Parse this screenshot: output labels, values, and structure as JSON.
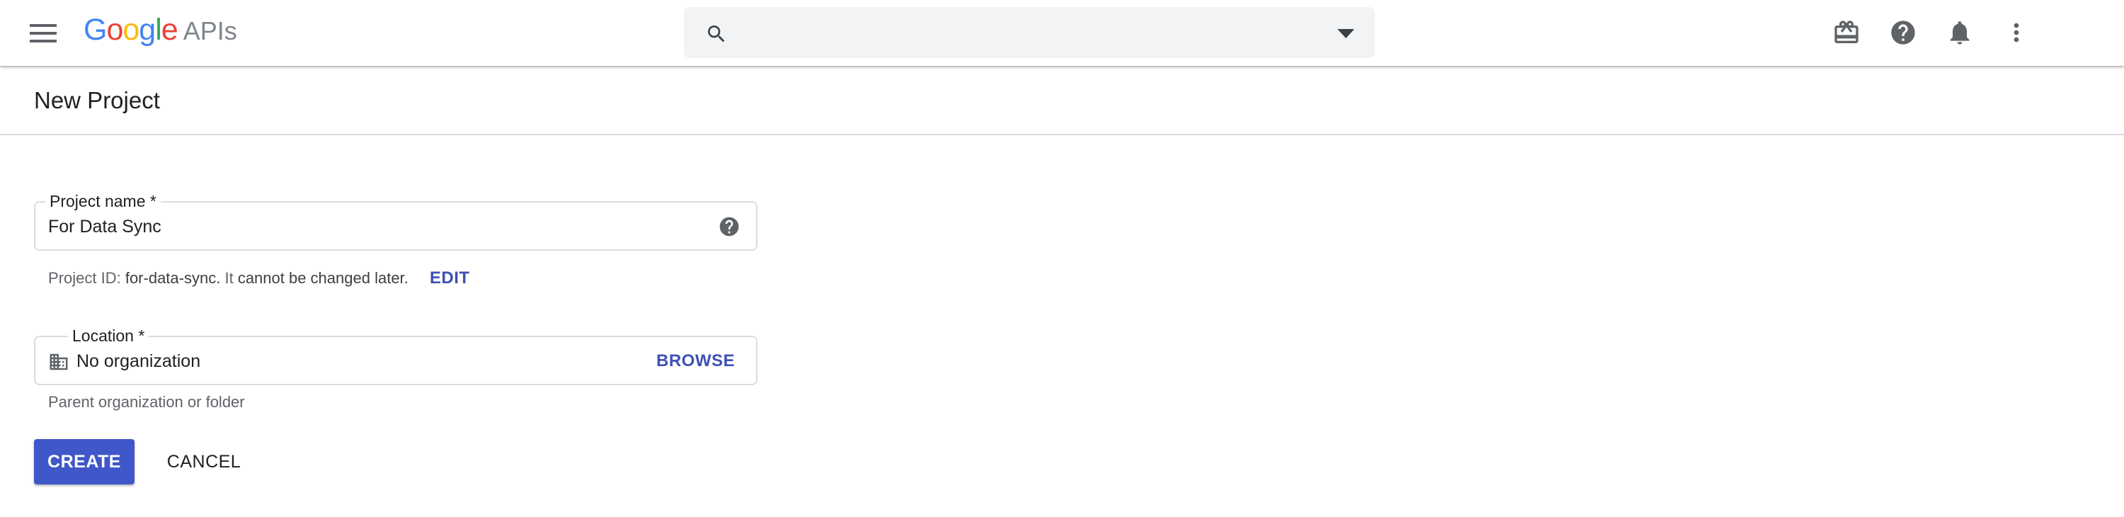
{
  "header": {
    "logo_google": "Google",
    "logo_product": "APIs",
    "search": {
      "value": "",
      "placeholder": ""
    },
    "icons": [
      "menu-icon",
      "search-icon",
      "dropdown-arrow-icon",
      "gift-icon",
      "help-icon",
      "notifications-bell-icon",
      "more-vert-icon"
    ]
  },
  "page": {
    "title": "New Project"
  },
  "form": {
    "project_name": {
      "label": "Project name *",
      "value": "For Data Sync"
    },
    "project_id": {
      "prefix": "Project ID:",
      "id": "for-data-sync.",
      "middle": "It",
      "emphasis": "cannot be changed later.",
      "edit_label": "EDIT"
    },
    "location": {
      "label": "Location *",
      "value": "No organization",
      "browse_label": "BROWSE",
      "hint": "Parent organization or folder"
    }
  },
  "actions": {
    "create_label": "CREATE",
    "cancel_label": "CANCEL"
  },
  "colors": {
    "accent": "#3f51b5",
    "create_button": "#3f57c9",
    "google_blue": "#4285f4",
    "google_red": "#ea4335",
    "google_yellow": "#fbbc05",
    "google_green": "#34a853"
  }
}
